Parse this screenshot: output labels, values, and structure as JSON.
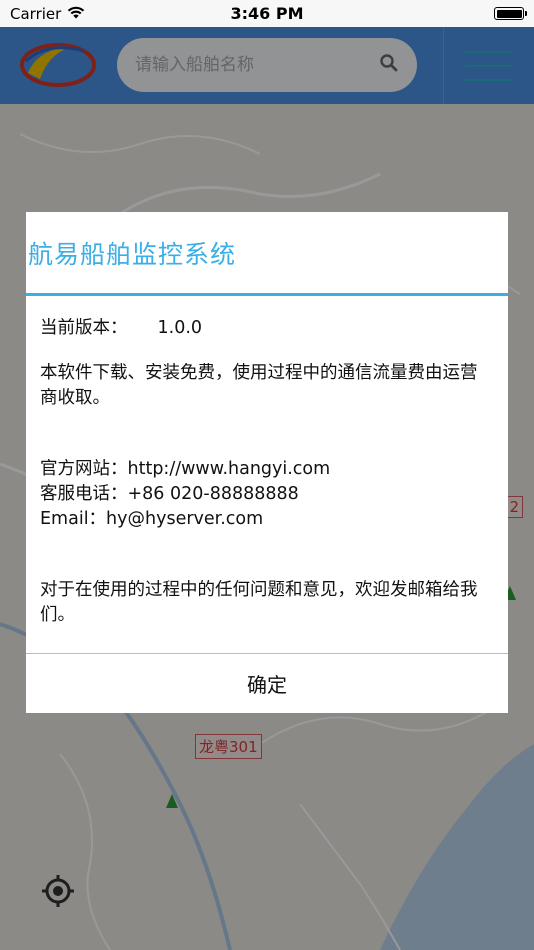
{
  "status_bar": {
    "carrier": "Carrier",
    "time": "3:46 PM"
  },
  "search": {
    "placeholder": "请输入船舶名称"
  },
  "map": {
    "ship_labels": [
      "22",
      "龙粤301"
    ]
  },
  "dialog": {
    "title": "航易船舶监控系统",
    "version_label": "当前版本：",
    "version_value": "1.0.0",
    "notice": "本软件下载、安装免费，使用过程中的通信流量费由运营商收取。",
    "website": "官方网站：http://www.hangyi.com",
    "phone": "客服电话：+86 020-88888888",
    "email": "Email：hy@hyserver.com",
    "feedback": "对于在使用的过程中的任何问题和意见，欢迎发邮箱给我们。",
    "confirm_label": "确定"
  },
  "colors": {
    "accent": "#3aaee6",
    "top_bar": "#4a8fe2",
    "ship_label_border": "#d65c5c"
  }
}
